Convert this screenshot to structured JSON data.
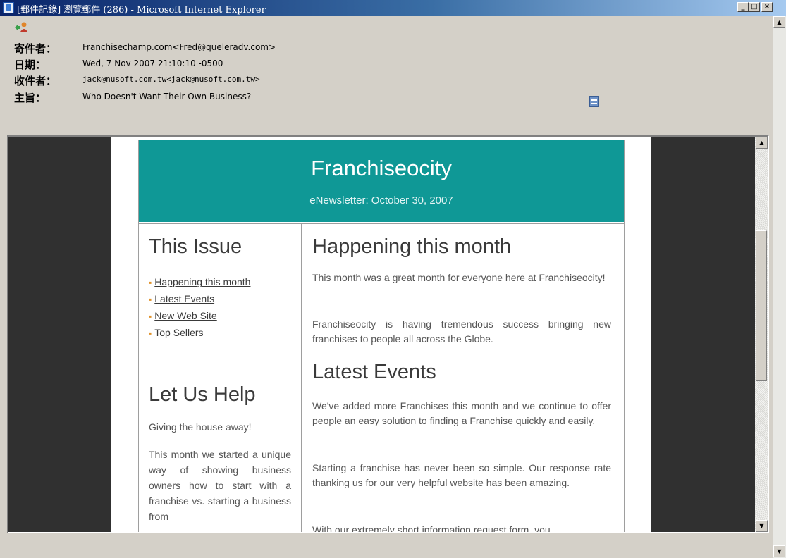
{
  "window": {
    "title": "[郵件記錄] 瀏覽郵件 (286) - Microsoft Internet Explorer",
    "minimize_glyph": "_",
    "maximize_glyph": "□",
    "close_glyph": "×"
  },
  "header": {
    "from_label": "寄件者：",
    "from_value": "Franchisechamp.com<Fred@queleradv.com>",
    "date_label": "日期：",
    "date_value": "Wed, 7 Nov 2007 21:10:10 -0500",
    "to_label": "收件者：",
    "to_value": "jack@nusoft.com.tw<jack@nusoft.com.tw>",
    "subject_label": "主旨：",
    "subject_value": "Who Doesn't Want Their Own Business?"
  },
  "newsletter": {
    "title": "Franchiseocity",
    "subtitle": "eNewsletter: October 30, 2007",
    "this_issue_heading": "This Issue",
    "issue_links": [
      "Happening this month",
      "Latest Events",
      "New Web Site",
      "Top Sellers"
    ],
    "help_heading": "Let Us Help",
    "help_subtitle": "Giving the house away!",
    "help_body": "This month we started a unique way of showing business owners how to start with a franchise vs. starting a business from",
    "happening_heading": "Happening this month",
    "happening_p1": "This month was a great month for everyone here at Franchiseocity!",
    "happening_p2": "Franchiseocity is having tremendous success bringing new franchises to people all across the Globe.",
    "events_heading": "Latest Events",
    "events_p1": "We've added more Franchises this month  and we continue to offer people an easy solution to finding a Franchise quickly and easily.",
    "events_p2": "Starting a franchise has never been so simple. Our response rate thanking us for our very helpful website has been amazing.",
    "events_p3": "With our extremely short information request form, you"
  }
}
